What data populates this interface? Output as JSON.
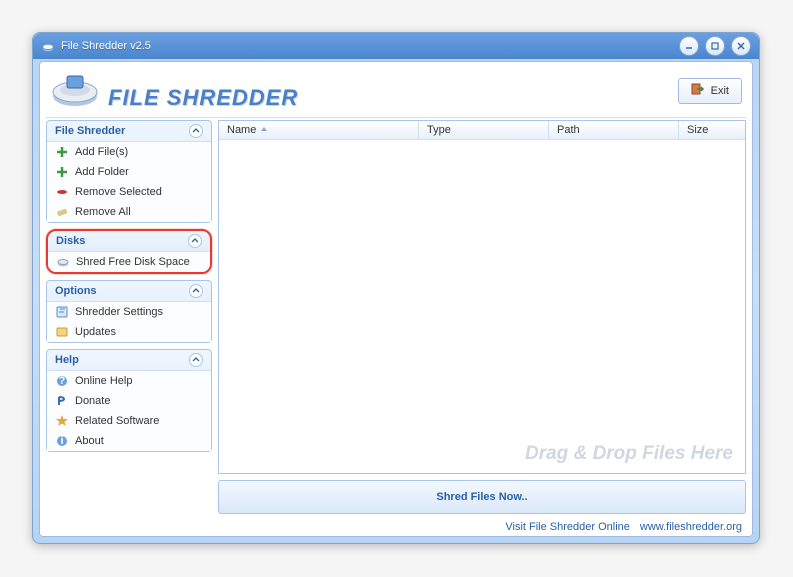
{
  "window": {
    "title": "File Shredder v2.5"
  },
  "header": {
    "app_name": "FILE SHREDDER",
    "exit_label": "Exit"
  },
  "sidebar": {
    "panels": [
      {
        "title": "File Shredder",
        "items": [
          {
            "label": "Add File(s)",
            "icon": "plus"
          },
          {
            "label": "Add Folder",
            "icon": "plus"
          },
          {
            "label": "Remove Selected",
            "icon": "remove"
          },
          {
            "label": "Remove All",
            "icon": "eraser"
          }
        ]
      },
      {
        "title": "Disks",
        "items": [
          {
            "label": "Shred Free Disk Space",
            "icon": "disk"
          }
        ]
      },
      {
        "title": "Options",
        "items": [
          {
            "label": "Shredder Settings",
            "icon": "settings"
          },
          {
            "label": "Updates",
            "icon": "updates"
          }
        ]
      },
      {
        "title": "Help",
        "items": [
          {
            "label": "Online Help",
            "icon": "help"
          },
          {
            "label": "Donate",
            "icon": "donate"
          },
          {
            "label": "Related Software",
            "icon": "star"
          },
          {
            "label": "About",
            "icon": "about"
          }
        ]
      }
    ]
  },
  "listview": {
    "columns": [
      "Name",
      "Type",
      "Path",
      "Size"
    ],
    "drag_hint": "Drag & Drop Files Here"
  },
  "actions": {
    "shred_now": "Shred Files Now.."
  },
  "footer": {
    "visit": "Visit File Shredder Online",
    "url": "www.fileshredder.org"
  }
}
